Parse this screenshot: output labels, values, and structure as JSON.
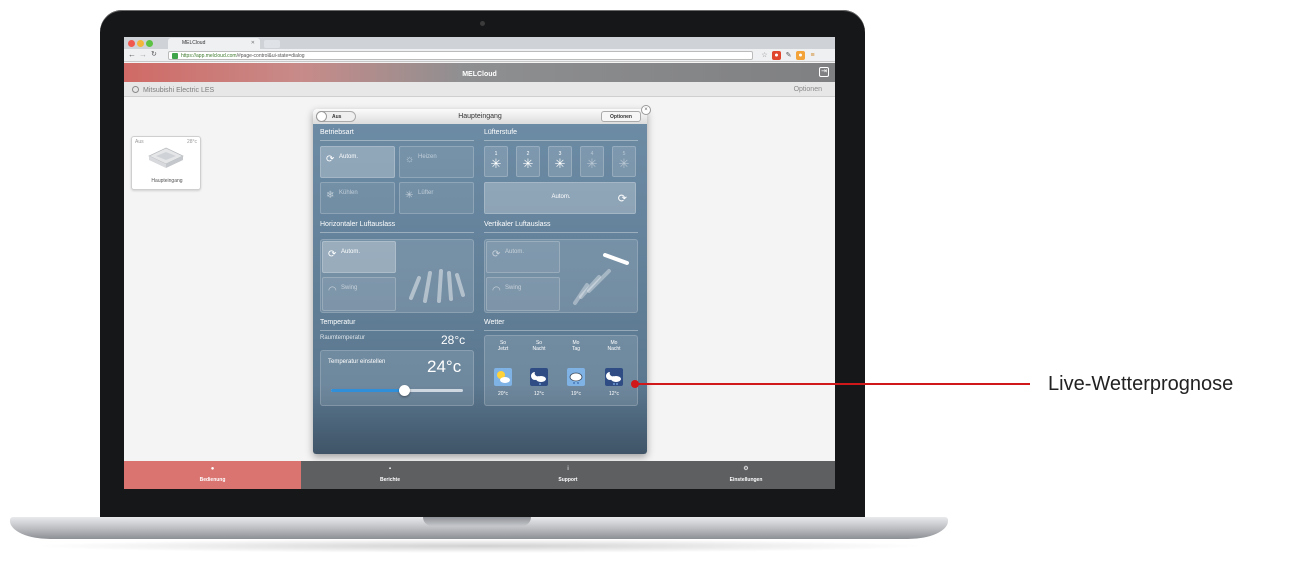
{
  "browser": {
    "tab_title": "MELCloud",
    "url_host": "https://app.melcloud.com",
    "url_rest": "/#page-control&ui-state=dialog"
  },
  "app": {
    "title": "MELCloud",
    "building": "Mitsubishi Electric LES",
    "options_link": "Optionen"
  },
  "unit_card": {
    "state": "Aus",
    "temp": "28°c",
    "name": "Haupteingang"
  },
  "dialog": {
    "power_label": "Aus",
    "title": "Haupteingang",
    "options_button": "Optionen",
    "mode": {
      "title": "Betriebsart",
      "buttons": [
        "Autom.",
        "Heizen",
        "Kühlen",
        "Lüfter"
      ],
      "selected": "Autom."
    },
    "fan": {
      "title": "Lüfterstufe",
      "speeds": [
        "1",
        "2",
        "3",
        "4",
        "5"
      ],
      "auto_label": "Autom."
    },
    "horizontal_vane": {
      "title": "Horizontaler Luftauslass",
      "auto_label": "Autom.",
      "swing_label": "Swing"
    },
    "vertical_vane": {
      "title": "Vertikaler Luftauslass",
      "auto_label": "Autom.",
      "swing_label": "Swing"
    },
    "temperature": {
      "title": "Temperatur",
      "room_label": "Raumtemperatur",
      "room_value": "28°c",
      "set_label": "Temperatur einstellen",
      "set_value": "24°c",
      "slider_level": 0.55
    },
    "weather": {
      "title": "Wetter",
      "days": [
        {
          "line1": "So",
          "line2": "Jetzt",
          "temp": "20°c",
          "icon": "sun-cloud-icon"
        },
        {
          "line1": "So",
          "line2": "Nacht",
          "temp": "12°c",
          "icon": "moon-cloud-rain-icon"
        },
        {
          "line1": "Mo",
          "line2": "Tag",
          "temp": "19°c",
          "icon": "cloud-rain-icon"
        },
        {
          "line1": "Mo",
          "line2": "Nacht",
          "temp": "12°c",
          "icon": "moon-cloud-rain-icon"
        }
      ]
    }
  },
  "bottom_nav": [
    "Bedienung",
    "Berichte",
    "Support",
    "Einstellungen"
  ],
  "callout": {
    "label": "Live-Wetterprognose",
    "color": "#d0181a"
  },
  "colors": {
    "accent": "#d97470",
    "panel": "#5b7890",
    "slider": "#2f8fd8"
  }
}
